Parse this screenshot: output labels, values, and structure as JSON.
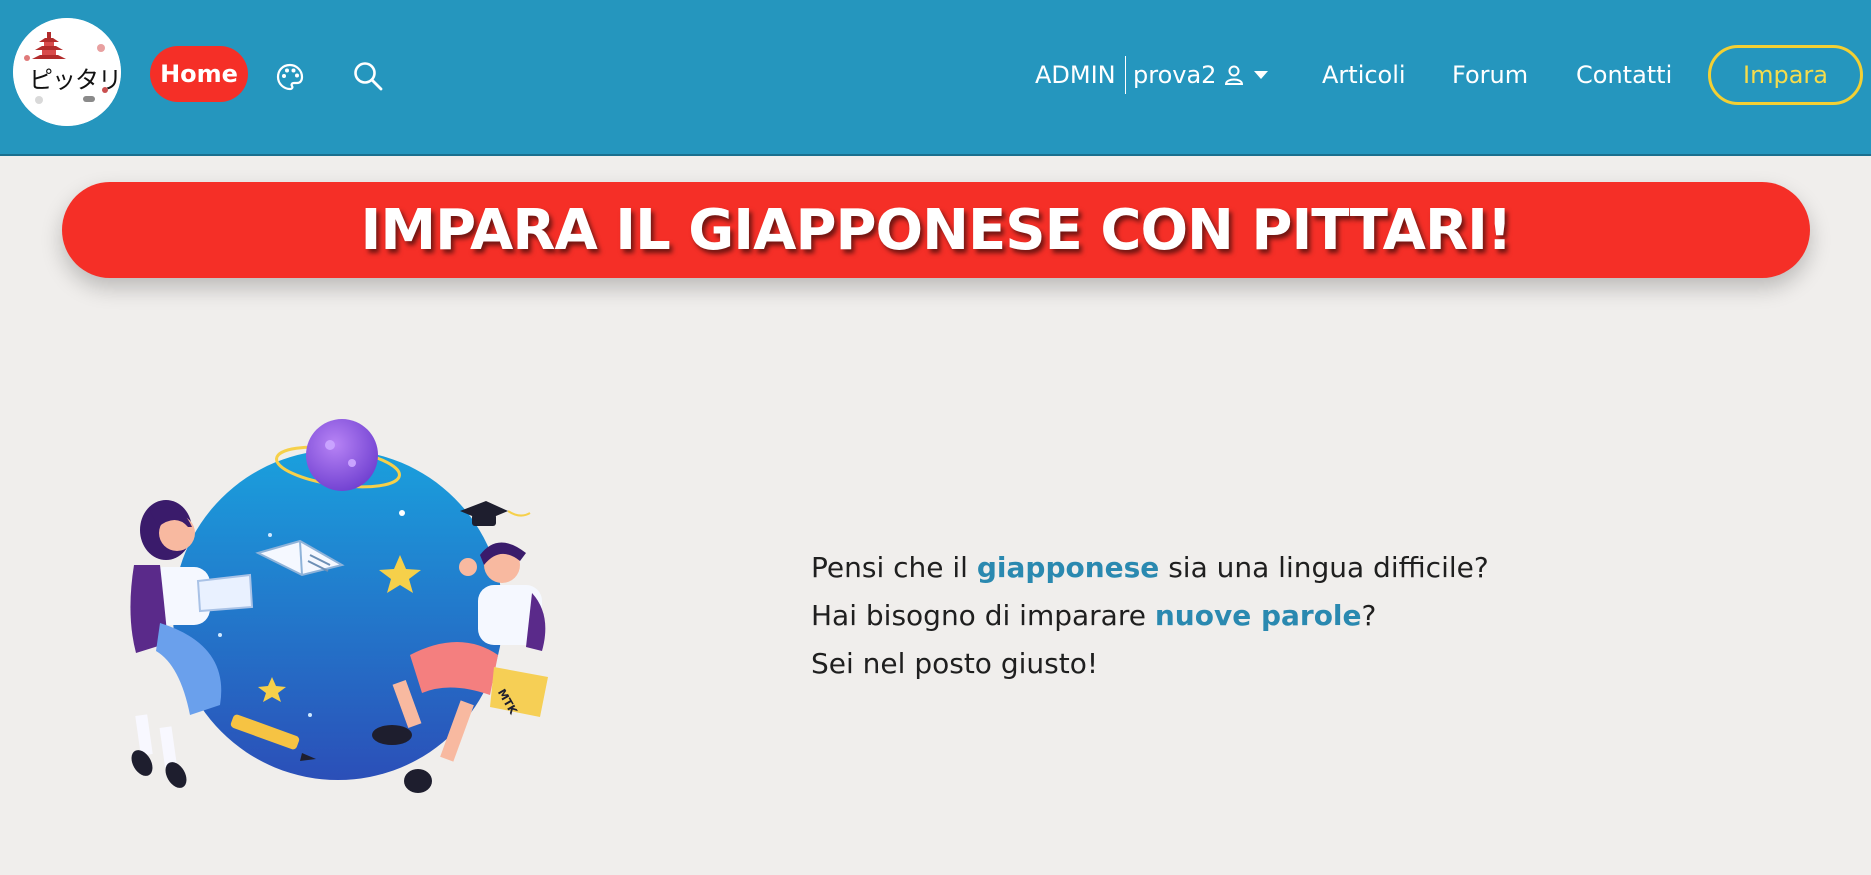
{
  "header": {
    "logo_text": "ピッタリ",
    "home_label": "Home",
    "palette_icon": "palette-icon",
    "search_icon": "search-icon",
    "admin_label": "ADMIN",
    "username": "prova2",
    "user_icon": "user-icon",
    "nav": [
      {
        "label": "Articoli"
      },
      {
        "label": "Forum"
      },
      {
        "label": "Contatti"
      }
    ],
    "cta_label": "Impara"
  },
  "hero": {
    "title": "IMPARA IL GIAPPONESE CON PITTARI!"
  },
  "intro": {
    "line1_pre": "Pensi che il ",
    "line1_hl": "giapponese",
    "line1_post": " sia una lingua difficile?",
    "line2_pre": "Hai bisogno di imparare ",
    "line2_hl": "nuove parole",
    "line2_post": "?",
    "line3": "Sei nel posto giusto!"
  },
  "illustration": {
    "book_label": "MTK"
  },
  "colors": {
    "navbar": "#2596be",
    "accent_red": "#f52f27",
    "cta_yellow": "#f3d033",
    "highlight": "#2a89b0",
    "background": "#f0eeec"
  }
}
